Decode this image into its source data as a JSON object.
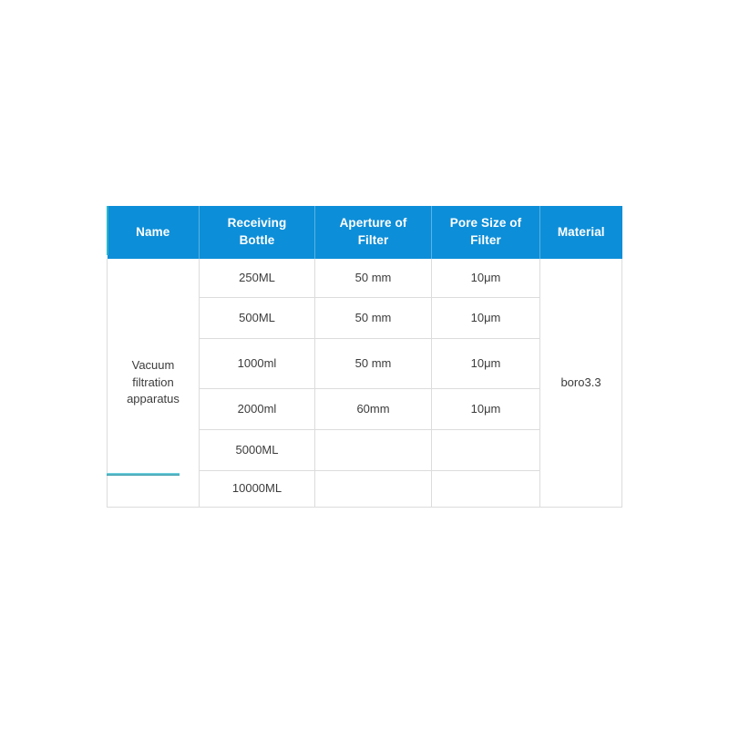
{
  "table": {
    "columns": [
      {
        "key": "name",
        "label": "Name"
      },
      {
        "key": "bottle",
        "label": "Receiving Bottle"
      },
      {
        "key": "aperture",
        "label": "Aperture of Filter"
      },
      {
        "key": "pore",
        "label": "Pore Size of Filter"
      },
      {
        "key": "material",
        "label": "Material"
      }
    ],
    "header_labels": {
      "name": "Name",
      "bottle_line1": "Receiving",
      "bottle_line2": "Bottle",
      "aperture_line1": "Aperture of",
      "aperture_line2": "Filter",
      "pore_line1": "Pore Size of",
      "pore_line2": "Filter",
      "material": "Material"
    },
    "merged_cells": {
      "name_value_line1": "Vacuum",
      "name_value_line2": "filtration",
      "name_value_line3": "apparatus",
      "name_value": "Vacuum filtration apparatus",
      "material_value": "boro3.3"
    },
    "rows": [
      {
        "bottle": "250ML",
        "aperture": "50 mm",
        "pore": "10μm"
      },
      {
        "bottle": "500ML",
        "aperture": "50 mm",
        "pore": "10μm"
      },
      {
        "bottle": "1000ml",
        "aperture": "50 mm",
        "pore": "10μm"
      },
      {
        "bottle": "2000ml",
        "aperture": "60mm",
        "pore": "10μm"
      },
      {
        "bottle": "5000ML",
        "aperture": "",
        "pore": ""
      },
      {
        "bottle": "10000ML",
        "aperture": "",
        "pore": ""
      }
    ]
  },
  "colors": {
    "header_background": "#0d8ed8",
    "header_text": "#ffffff",
    "body_text": "#3c3c3c",
    "cell_border": "#dcdcdc",
    "accent_cyan": "#6fd0de",
    "accent_teal": "#3e9fae",
    "page_background": "#ffffff"
  }
}
